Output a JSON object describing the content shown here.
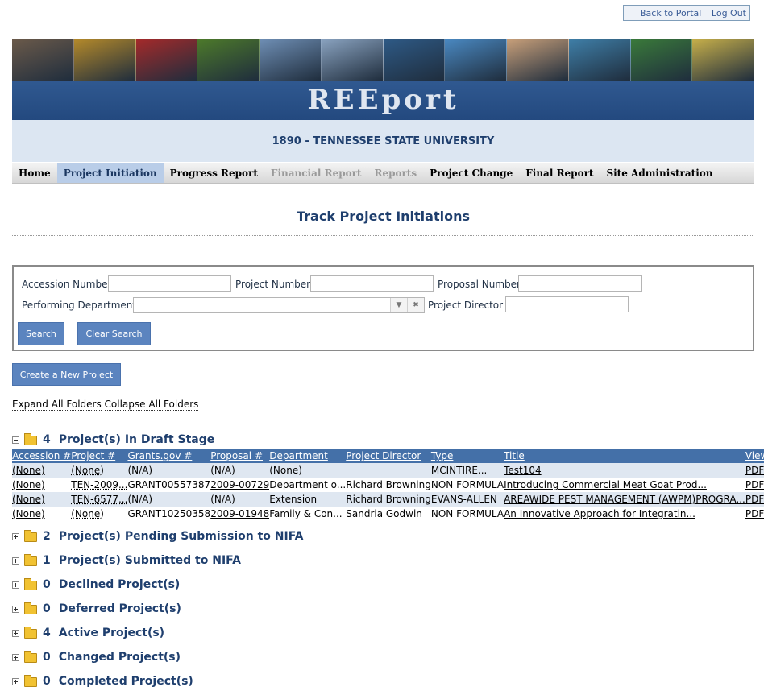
{
  "portal": {
    "back_label": "Back to Portal",
    "logout_label": "Log Out"
  },
  "banner": {
    "brand": "REEport",
    "photo_colors": [
      "#6b5a4a",
      "#b58a2a",
      "#a52a2a",
      "#4d7a2a",
      "#6f8fb5",
      "#8aa3c0",
      "#2e5a86",
      "#4a89c2",
      "#c9a07a",
      "#3f7fa8",
      "#3a7a3a",
      "#c8b04a"
    ]
  },
  "institution": "1890 - TENNESSEE STATE UNIVERSITY",
  "nav": {
    "home": "Home",
    "project_initiation": "Project Initiation",
    "progress_report": "Progress Report",
    "financial_report": "Financial Report",
    "reports": "Reports",
    "project_change": "Project Change",
    "final_report": "Final Report",
    "site_administration": "Site Administration"
  },
  "page_title": "Track Project Initiations",
  "search": {
    "accession_label": "Accession Number",
    "accession_value": "",
    "project_label": "Project Number",
    "project_value": "",
    "proposal_label": "Proposal Number",
    "proposal_value": "",
    "department_label": "Performing Department",
    "department_value": "",
    "director_label": "Project Director",
    "director_value": "",
    "search_button": "Search",
    "clear_button": "Clear Search"
  },
  "create_button": "Create a New Project",
  "folders": {
    "expand_all": "Expand All Folders",
    "collapse_all": "Collapse All Folders"
  },
  "draft_group": {
    "count": "4",
    "label": "Project(s) In Draft Stage",
    "columns": {
      "accession": "Accession #",
      "project": "Project #",
      "grants_gov": "Grants.gov #",
      "proposal": "Proposal #",
      "department": "Department",
      "director": "Project Director",
      "type": "Type",
      "title": "Title",
      "view": "View"
    },
    "rows": [
      {
        "accession": "(None)",
        "project": "(None)",
        "grants_gov": "(N/A)",
        "proposal": "(N/A)",
        "department": "(None)",
        "director": "",
        "type": "MCINTIRE...",
        "title": "Test104",
        "view": "PDF"
      },
      {
        "accession": "(None)",
        "project": "TEN-2009...",
        "grants_gov": "GRANT00557387",
        "proposal": "2009-00729",
        "department": "Department o...",
        "director": "Richard Browning",
        "type": "NON FORMULA",
        "title": "Introducing Commercial Meat Goat Prod...",
        "view": "PDF"
      },
      {
        "accession": "(None)",
        "project": "TEN-6577...",
        "grants_gov": "(N/A)",
        "proposal": "(N/A)",
        "department": "Extension",
        "director": "Richard Browning",
        "type": "EVANS-ALLEN",
        "title": "AREAWIDE PEST MANAGEMENT (AWPM)PROGRA...",
        "view": "PDF"
      },
      {
        "accession": "(None)",
        "project": "(None)",
        "grants_gov": "GRANT10250358",
        "proposal": "2009-01948",
        "department": "Family & Con...",
        "director": "Sandria Godwin",
        "type": "NON FORMULA",
        "title": "An Innovative Approach for Integratin...",
        "view": "PDF"
      }
    ]
  },
  "groups": [
    {
      "count": "2",
      "label": "Project(s) Pending Submission to NIFA"
    },
    {
      "count": "1",
      "label": "Project(s) Submitted to NIFA"
    },
    {
      "count": "0",
      "label": "Declined Project(s)"
    },
    {
      "count": "0",
      "label": "Deferred Project(s)"
    },
    {
      "count": "4",
      "label": "Active Project(s)"
    },
    {
      "count": "0",
      "label": "Changed Project(s)"
    },
    {
      "count": "0",
      "label": "Completed Project(s)"
    }
  ]
}
